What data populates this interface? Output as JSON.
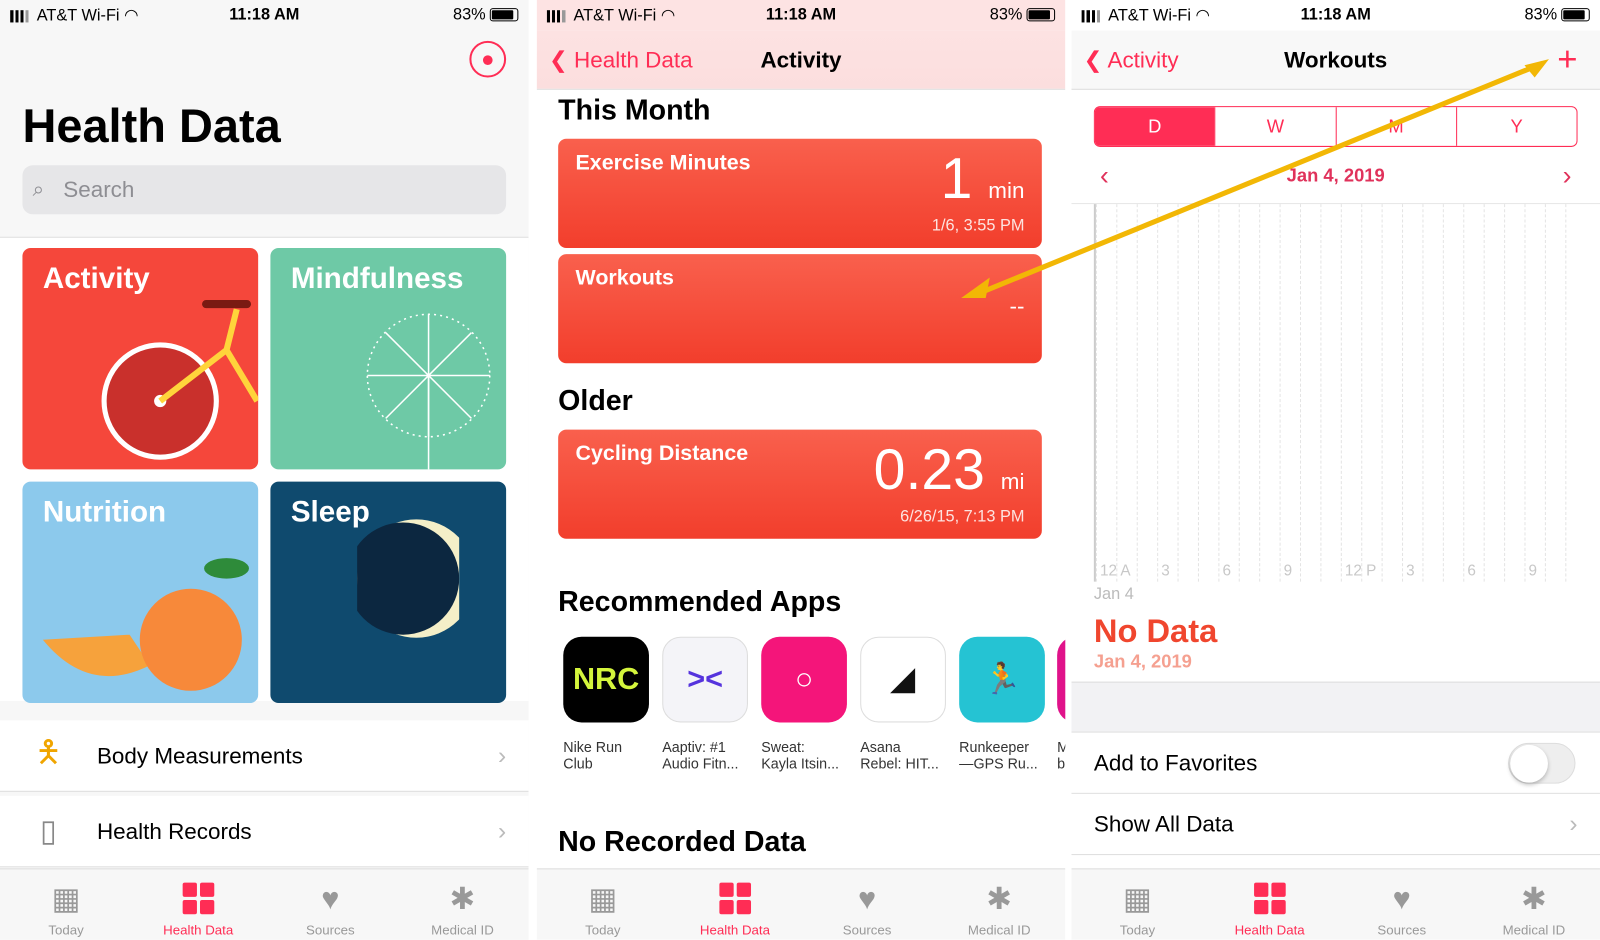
{
  "status": {
    "carrier": "AT&T Wi-Fi",
    "time": "11:18 AM",
    "battery": "83%"
  },
  "tabs": [
    {
      "label": "Today",
      "icon": "calendar-icon"
    },
    {
      "label": "Health Data",
      "icon": "grid-icon"
    },
    {
      "label": "Sources",
      "icon": "heart-icon"
    },
    {
      "label": "Medical ID",
      "icon": "asterisk-icon"
    }
  ],
  "active_tab": "Health Data",
  "accent": "#ff2d55",
  "panel1": {
    "title": "Health Data",
    "search_placeholder": "Search",
    "tiles": [
      {
        "label": "Activity",
        "color": "#f5473b"
      },
      {
        "label": "Mindfulness",
        "color": "#6ec9a6"
      },
      {
        "label": "Nutrition",
        "color": "#8cc9ec"
      },
      {
        "label": "Sleep",
        "color": "#0f4a6e"
      }
    ],
    "rows": [
      {
        "label": "Body Measurements"
      },
      {
        "label": "Health Records"
      }
    ]
  },
  "panel2": {
    "back": "Health Data",
    "title": "Activity",
    "this_month": "This Month",
    "exercise": {
      "name": "Exercise Minutes",
      "value": "1",
      "unit": "min",
      "date": "1/6, 3:55 PM"
    },
    "workouts": {
      "name": "Workouts",
      "value": "--"
    },
    "older": "Older",
    "cycling": {
      "name": "Cycling Distance",
      "value": "0.23",
      "unit": "mi",
      "date": "6/26/15, 7:13 PM"
    },
    "recommended": "Recommended Apps",
    "apps": [
      {
        "line1": "Nike Run",
        "line2": "Club",
        "logo": "NRC"
      },
      {
        "line1": "Aaptiv: #1",
        "line2": "Audio Fitn..."
      },
      {
        "line1": "Sweat:",
        "line2": "Kayla Itsin..."
      },
      {
        "line1": "Asana",
        "line2": "Rebel: HIT..."
      },
      {
        "line1": "Runkeeper",
        "line2": "—GPS Ru..."
      },
      {
        "line1": "M",
        "line2": "b"
      }
    ],
    "no_recorded": "No Recorded Data"
  },
  "panel3": {
    "back": "Activity",
    "title": "Workouts",
    "add": "+",
    "segments": [
      "D",
      "W",
      "M",
      "Y"
    ],
    "selected_segment": "D",
    "date": "Jan 4, 2019",
    "chart_ticks": [
      "12 A",
      "3",
      "6",
      "9",
      "12 P",
      "3",
      "6",
      "9"
    ],
    "chart_day": "Jan 4",
    "no_data": "No Data",
    "no_data_date": "Jan 4, 2019",
    "add_favorites": "Add to Favorites",
    "favorites_on": false,
    "show_all": "Show All Data"
  }
}
